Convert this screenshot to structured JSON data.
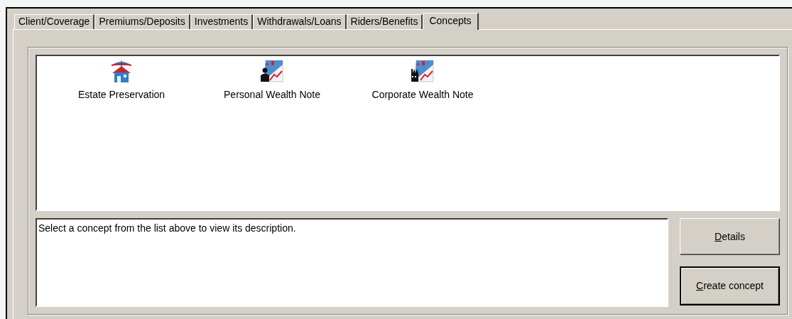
{
  "tabs": [
    {
      "label": "Client/Coverage",
      "selected": false
    },
    {
      "label": "Premiums/Deposits",
      "selected": false
    },
    {
      "label": "Investments",
      "selected": false
    },
    {
      "label": "Withdrawals/Loans",
      "selected": false
    },
    {
      "label": "Riders/Benefits",
      "selected": false
    },
    {
      "label": "Concepts",
      "selected": true
    }
  ],
  "concepts": [
    {
      "label": "Estate Preservation",
      "kind": "house"
    },
    {
      "label": "Personal Wealth Note",
      "kind": "person"
    },
    {
      "label": "Corporate Wealth Note",
      "kind": "factory"
    }
  ],
  "description": "Select a concept from the list above to view its description.",
  "buttons": [
    {
      "label": "Details",
      "mnemonic": true,
      "default": false
    },
    {
      "label": "Create concept",
      "mnemonic": true,
      "default": true
    }
  ]
}
